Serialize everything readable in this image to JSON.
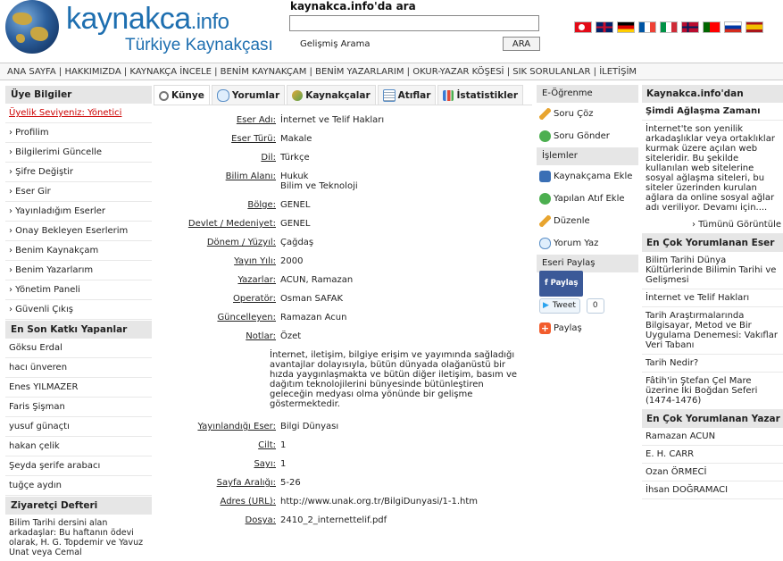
{
  "header": {
    "logo_text": "kaynakca",
    "logo_domain": ".info",
    "logo_subtitle": "Türkiye Kaynakçası",
    "search_title": "kaynakca.info'da ara",
    "advanced_search": "Gelişmiş Arama",
    "search_button": "ARA",
    "flags": [
      "turkey",
      "uk",
      "germany",
      "france",
      "italy",
      "norway",
      "portugal",
      "russia",
      "spain"
    ]
  },
  "topnav": "ANA SAYFA | HAKKIMIZDA | KAYNAKÇA İNCELE | BENİM KAYNAKÇAM | BENİM YAZARLARIM | OKUR-YAZAR KÖŞESİ | SIK SORULANLAR | İLETİŞİM",
  "left": {
    "user_head": "Üye Bilgiler",
    "membership": "Üyelik Seviyeniz: Yönetici",
    "menu": [
      "› Profilim",
      "› Bilgilerimi Güncelle",
      "› Şifre Değiştir",
      "› Eser Gir",
      "› Yayınladığım Eserler",
      "› Onay Bekleyen Eserlerim",
      "› Benim Kaynakçam",
      "› Benim Yazarlarım",
      "› Yönetim Paneli",
      "› Güvenli Çıkış"
    ],
    "contrib_head": "En Son Katkı Yapanlar",
    "contributors": [
      "Göksu Erdal",
      "hacı ünveren",
      "Enes YILMAZER",
      "Faris Şişman",
      "yusuf günaçtı",
      "hakan çelik",
      "Şeyda şerife arabacı",
      "tuğçe aydın"
    ],
    "guest_head": "Ziyaretçi Defteri",
    "guest_text": "Bilim Tarihi dersini alan arkadaşlar: Bu haftanın ödevi olarak, H. G. Topdemir ve Yavuz Unat veya Cemal"
  },
  "tabs": [
    "Künye",
    "Yorumlar",
    "Kaynakçalar",
    "Atıflar",
    "İstatistikler"
  ],
  "record": {
    "rows": [
      {
        "label": "Eser Adı:",
        "value": "İnternet ve Telif Hakları"
      },
      {
        "label": "Eser Türü:",
        "value": "Makale"
      },
      {
        "label": "Dil:",
        "value": "Türkçe"
      },
      {
        "label": "Bilim Alanı:",
        "value": "Hukuk\nBilim ve Teknoloji"
      },
      {
        "label": "Bölge:",
        "value": "GENEL"
      },
      {
        "label": "Devlet / Medeniyet:",
        "value": "GENEL"
      },
      {
        "label": "Dönem / Yüzyıl:",
        "value": "Çağdaş"
      },
      {
        "label": "Yayın Yılı:",
        "value": "2000"
      },
      {
        "label": "Yazarlar:",
        "value": "ACUN, Ramazan"
      },
      {
        "label": "Operatör:",
        "value": "Osman SAFAK"
      },
      {
        "label": "Güncelleyen:",
        "value": "Ramazan Acun"
      },
      {
        "label": "Notlar:",
        "value": "Özet"
      },
      {
        "label": "Yayınlandığı Eser:",
        "value": "Bilgi Dünyası"
      },
      {
        "label": "Cilt:",
        "value": "1"
      },
      {
        "label": "Sayı:",
        "value": "1"
      },
      {
        "label": "Sayfa Aralığı:",
        "value": "5-26"
      },
      {
        "label": "Adres (URL):",
        "value": "http://www.unak.org.tr/BilgiDunyasi/1-1.htm"
      },
      {
        "label": "Dosya:",
        "value": "2410_2_internettelif.pdf"
      }
    ],
    "abstract": "İnternet, iletişim, bilgiye erişim ve yayımında sağladığı avantajlar dolayısıyla, bütün dünyada olağanüstü bir hızda yaygınlaşmakta ve bütün diğer iletişim, basım ve dağıtım teknolojilerini bünyesinde bütünleştiren geleceğin medyası olma yönünde bir gelişme göstermektedir."
  },
  "actions": {
    "elearn_head": "E-Öğrenme",
    "elearn": [
      "Soru Çöz",
      "Soru Gönder"
    ],
    "ops_head": "İşlemler",
    "ops": [
      "Kaynakçama Ekle",
      "Yapılan Atıf Ekle",
      "Düzenle",
      "Yorum Yaz"
    ],
    "share_head": "Eseri Paylaş",
    "fb_label": "Paylaş",
    "tweet_label": "Tweet",
    "tweet_count": "0",
    "share_label": "Paylaş"
  },
  "right": {
    "from_head": "Kaynakca.info'dan",
    "article_title": "Şimdi Ağlaşma Zamanı",
    "article_text": "İnternet'te son yenilik arkadaşlıklar veya ortaklıklar kurmak üzere açılan web siteleridir. Bu şekilde kullanılan web sitelerine sosyal ağlaşma siteleri, bu siteler üzerinden kurulan ağlara da online sosyal ağlar adı veriliyor. Devamı için....",
    "see_all": "› Tümünü Görüntüle",
    "most_works_head": "En Çok Yorumlanan Eser",
    "works": [
      "Bilim Tarihi Dünya Kültürlerinde Bilimin Tarihi ve Gelişmesi",
      "İnternet ve Telif Hakları",
      "Tarih Araştırmalarında Bilgisayar, Metod ve Bir Uygulama Denemesi: Vakıflar Veri Tabanı",
      "Tarih Nedir?",
      "Fâtih'in Ştefan Çel Mare üzerine İki Boğdan Seferi (1474-1476)"
    ],
    "most_authors_head": "En Çok Yorumlanan Yazar",
    "authors": [
      "Ramazan ACUN",
      "E. H. CARR",
      "Ozan ÖRMECİ",
      "İhsan DOĞRAMACI"
    ]
  }
}
